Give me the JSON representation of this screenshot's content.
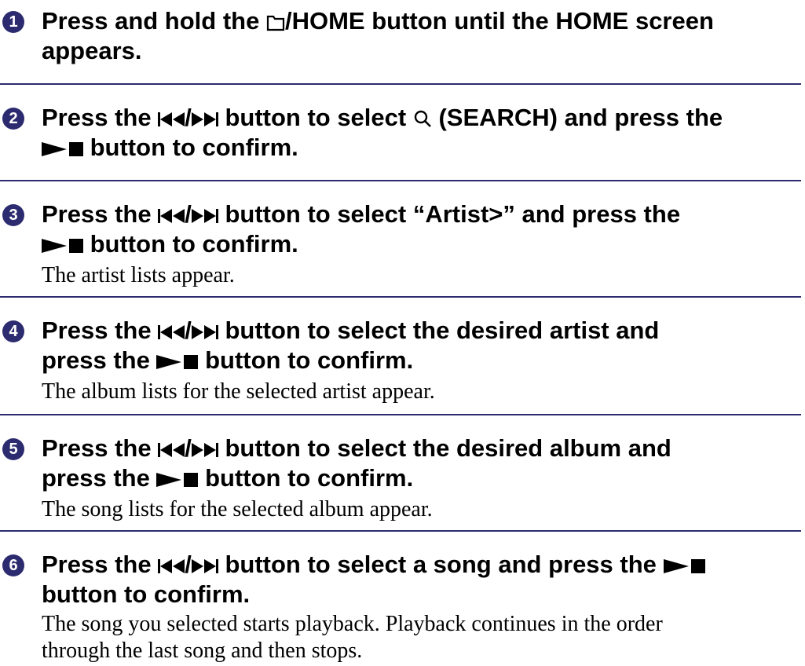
{
  "steps": [
    {
      "number": "1",
      "line1": {
        "before": "Press and hold the ",
        "icon_label": "/HOME",
        "after": " button until the HOME screen"
      },
      "line2": "appears.",
      "description": []
    },
    {
      "number": "2",
      "line1": {
        "before": "Press the ",
        "nav_sep": "/",
        "middle": " button to select ",
        "search_label": " (SEARCH) and press the"
      },
      "line2": " button to confirm.",
      "description": []
    },
    {
      "number": "3",
      "line1": {
        "before": "Press the ",
        "nav_sep": "/",
        "after": " button to select “Artist>” and press the"
      },
      "line2": " button to confirm.",
      "description": [
        "The artist lists appear."
      ]
    },
    {
      "number": "4",
      "line1": {
        "before": "Press the ",
        "nav_sep": "/",
        "after": " button to select the desired artist and"
      },
      "line2": {
        "before": "press the ",
        "after": " button to confirm."
      },
      "description": [
        "The album lists for the selected artist appear."
      ]
    },
    {
      "number": "5",
      "line1": {
        "before": "Press the ",
        "nav_sep": "/",
        "after": " button to select the desired album and"
      },
      "line2": {
        "before": "press the ",
        "after": " button to confirm."
      },
      "description": [
        "The song lists for the selected album appear."
      ]
    },
    {
      "number": "6",
      "line1": {
        "before": "Press the ",
        "nav_sep": "/",
        "after": " button to select a song and press the "
      },
      "line2": "button to confirm.",
      "description": [
        "The song you selected starts playback. Playback continues in the order",
        "through the last song and then stops."
      ]
    }
  ],
  "icons": {
    "folder": "folder-icon",
    "prev": "previous-track-icon",
    "next": "next-track-icon",
    "play_stop": "play-stop-icon",
    "search": "search-magnifier-icon"
  },
  "colors": {
    "accent": "#2c2b6f",
    "text": "#000000",
    "background": "#ffffff"
  }
}
